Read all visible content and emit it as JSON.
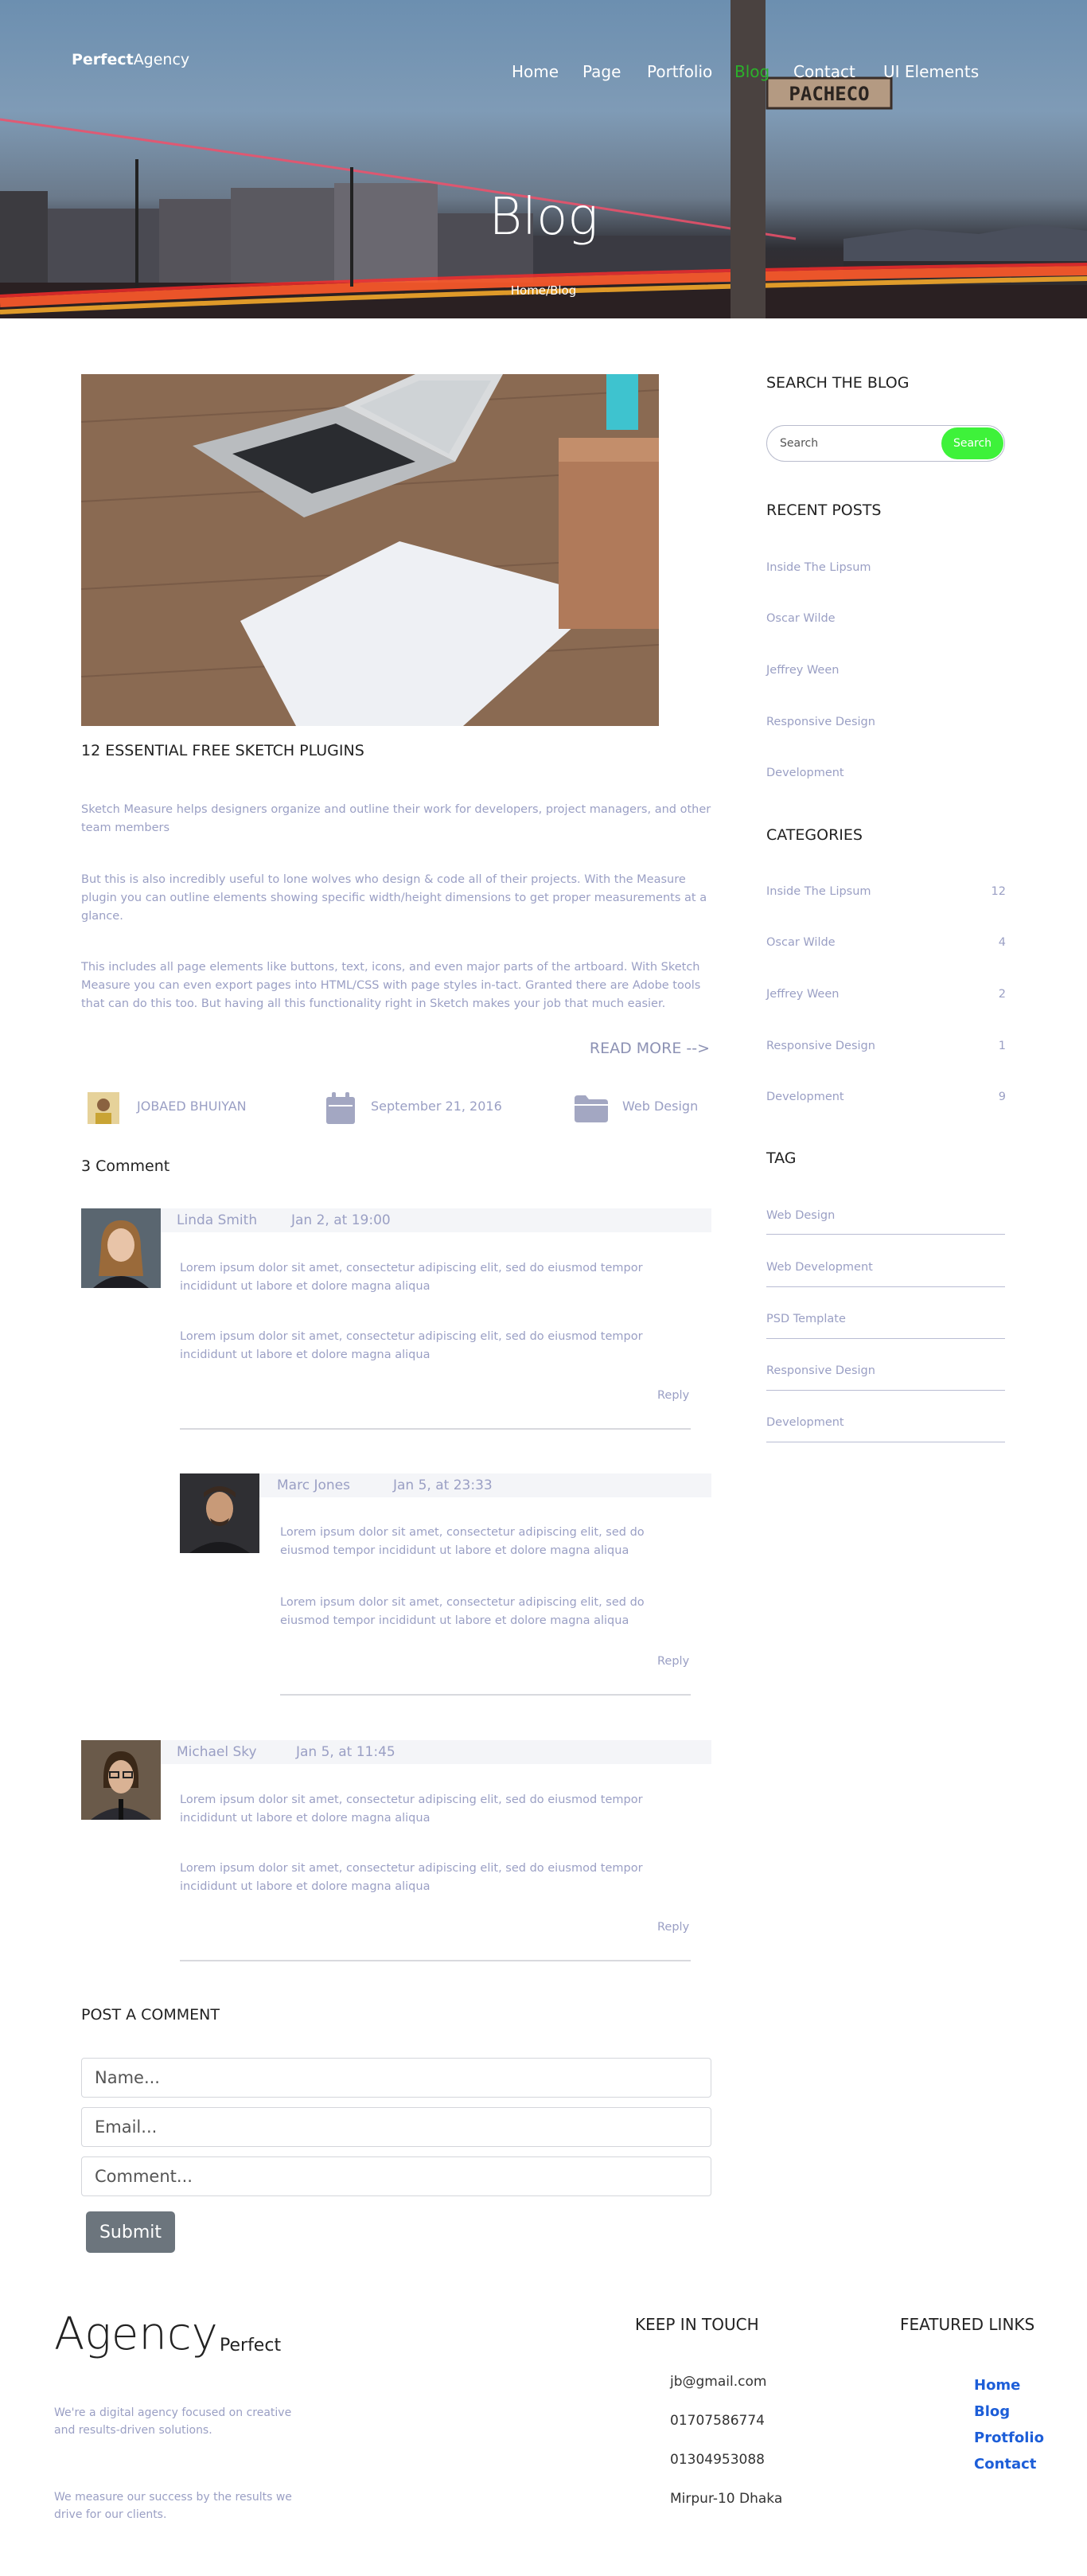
{
  "colors": {
    "accent_green": "#3ef23a",
    "nav_active_green": "#2bb12b",
    "link_blue": "#1d5ed8",
    "muted_text": "#9a9fc4",
    "submit_gray": "#6c757d"
  },
  "header": {
    "brand_bold": "Perfect",
    "brand_light": "Agency",
    "nav": [
      "Home",
      "Page",
      "Portfolio",
      "Blog",
      "Contact",
      "UI Elements"
    ],
    "active_nav": "Blog",
    "street_sign": "PACHECO",
    "title": "Blog",
    "breadcrumb": "Home/Blog"
  },
  "article": {
    "title": "12 ESSENTIAL FREE SKETCH PLUGINS",
    "paragraphs": [
      "Sketch Measure helps designers organize and outline their work for developers, project managers, and other team members",
      "But this is also incredibly useful to lone wolves who design & code all of their projects. With the Measure plugin you can outline elements showing specific width/height dimensions to get proper measurements at a glance.",
      "This includes all page elements like buttons, text, icons, and even major parts of the artboard. With Sketch Measure you can even export pages into HTML/CSS with page styles in-tact. Granted there are Adobe tools that can do this too. But having all this functionality right in Sketch makes your job that much easier."
    ],
    "read_more": "READ MORE -->",
    "author": "JOBAED BHUIYAN",
    "date": "September 21, 2016",
    "category": "Web Design"
  },
  "comments": {
    "title": "3 Comment",
    "items": [
      {
        "name": "Linda Smith",
        "date": "Jan 2, at 19:00",
        "p1": "Lorem ipsum dolor sit amet, consectetur adipiscing elit, sed do eiusmod tempor incididunt ut labore et dolore magna aliqua",
        "p2": "Lorem ipsum dolor sit amet, consectetur adipiscing elit, sed do eiusmod tempor incididunt ut labore et dolore magna aliqua",
        "reply": "Reply"
      },
      {
        "name": "Marc Jones",
        "date": "Jan 5, at 23:33",
        "p1": "Lorem ipsum dolor sit amet, consectetur adipiscing elit, sed do eiusmod tempor incididunt ut labore et dolore magna aliqua",
        "p2": "Lorem ipsum dolor sit amet, consectetur adipiscing elit, sed do eiusmod tempor incididunt ut labore et dolore magna aliqua",
        "reply": "Reply"
      },
      {
        "name": "Michael Sky",
        "date": "Jan 5, at 11:45",
        "p1": "Lorem ipsum dolor sit amet, consectetur adipiscing elit, sed do eiusmod tempor incididunt ut labore et dolore magna aliqua",
        "p2": "Lorem ipsum dolor sit amet, consectetur adipiscing elit, sed do eiusmod tempor incididunt ut labore et dolore magna aliqua",
        "reply": "Reply"
      }
    ]
  },
  "post_comment": {
    "title": "POST A COMMENT",
    "name_placeholder": "Name...",
    "email_placeholder": "Email...",
    "comment_placeholder": "Comment...",
    "submit": "Submit"
  },
  "sidebar": {
    "search_title": "SEARCH THE BLOG",
    "search_placeholder": "Search",
    "search_button": "Search",
    "recent_title": "RECENT POSTS",
    "recent": [
      "Inside The Lipsum",
      "Oscar Wilde",
      "Jeffrey Ween",
      "Responsive Design",
      "Development"
    ],
    "categories_title": "CATEGORIES",
    "categories": [
      {
        "name": "Inside The Lipsum",
        "count": "12"
      },
      {
        "name": "Oscar Wilde",
        "count": "4"
      },
      {
        "name": "Jeffrey Ween",
        "count": "2"
      },
      {
        "name": "Responsive Design",
        "count": "1"
      },
      {
        "name": "Development",
        "count": "9"
      }
    ],
    "tag_title": "TAG",
    "tags": [
      "Web Design",
      "Web Development",
      "PSD Template",
      "Responsive Design",
      "Development"
    ]
  },
  "footer": {
    "logo": "Agency",
    "logo_sub": "Perfect",
    "text1": "We're a digital agency focused on creative and results-driven solutions.",
    "text2": "We measure our success by the results we drive for our clients.",
    "keep_title": "KEEP IN TOUCH",
    "contacts": [
      "jb@gmail.com",
      "01707586774",
      "01304953088",
      "Mirpur-10 Dhaka"
    ],
    "featured_title": "FEATURED LINKS",
    "links": [
      "Home",
      "Blog",
      "Protfolio",
      "Contact"
    ]
  }
}
